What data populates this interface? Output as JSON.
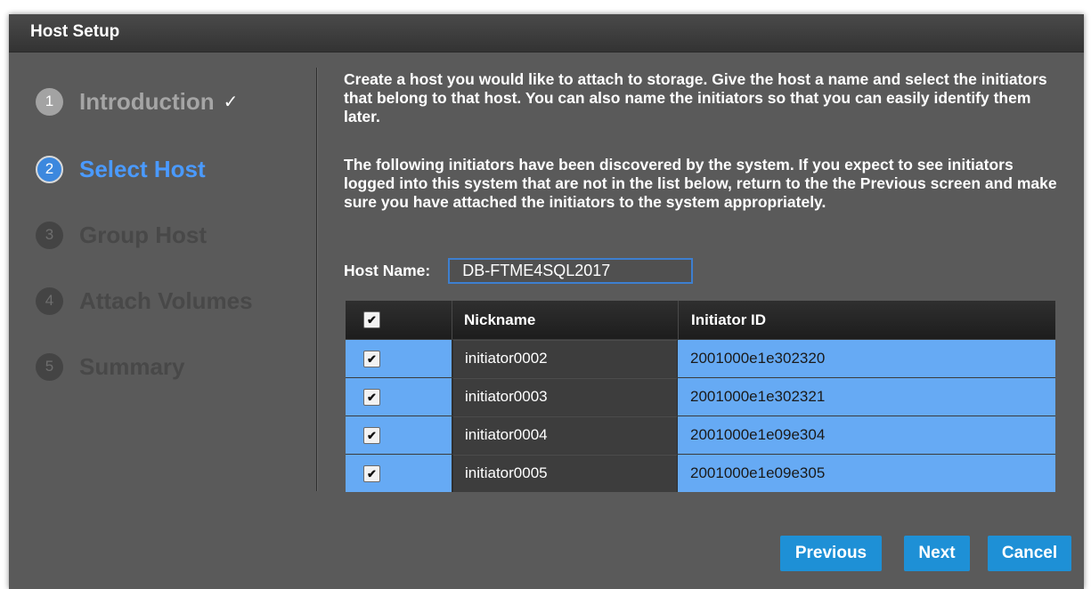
{
  "window": {
    "title": "Host Setup"
  },
  "steps": [
    {
      "num": "1",
      "label": "Introduction",
      "check": "✓"
    },
    {
      "num": "2",
      "label": "Select Host"
    },
    {
      "num": "3",
      "label": "Group Host"
    },
    {
      "num": "4",
      "label": "Attach Volumes"
    },
    {
      "num": "5",
      "label": "Summary"
    }
  ],
  "content": {
    "intro": "Create a host you would like to attach to storage. Give the host a name and select the initiators that belong to that host. You can also name the initiators so that you can easily identify them later.",
    "discovery": "The following initiators have been discovered by the system. If you expect to see initiators logged into this system that are not in the list below, return to the the Previous screen and make sure you have attached the initiators to the system appropriately.",
    "host_label": "Host Name:",
    "host_value": "DB-FTME4SQL2017"
  },
  "table": {
    "headers": {
      "select": "✔",
      "nickname": "Nickname",
      "initiator_id": "Initiator ID"
    },
    "rows": [
      {
        "check": "✔",
        "nickname": "initiator0002",
        "initiator_id": "2001000e1e302320"
      },
      {
        "check": "✔",
        "nickname": "initiator0003",
        "initiator_id": "2001000e1e302321"
      },
      {
        "check": "✔",
        "nickname": "initiator0004",
        "initiator_id": "2001000e1e09e304"
      },
      {
        "check": "✔",
        "nickname": "initiator0005",
        "initiator_id": "2001000e1e09e305"
      }
    ]
  },
  "buttons": {
    "previous": "Previous",
    "next": "Next",
    "cancel": "Cancel"
  },
  "colors": {
    "accent": "#1e90d6",
    "active_step": "#4a9aff",
    "row_highlight": "#66aaf4"
  }
}
